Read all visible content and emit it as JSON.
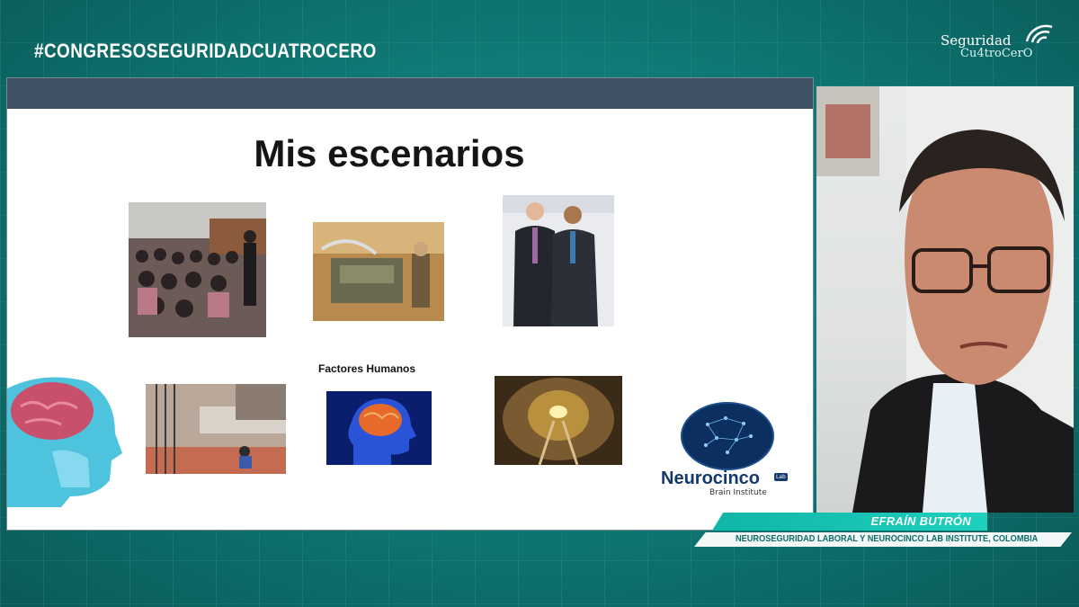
{
  "event": {
    "hashtag": "#CONGRESOSEGURIDADCUATROCERO",
    "brand_line1": "Seguridad",
    "brand_line2": "Cu4troCerO"
  },
  "slide": {
    "title": "Mis escenarios",
    "subheading": "Factores Humanos",
    "logo": {
      "name": "Neurocinco",
      "badge": "Lab",
      "subtitle": "Brain Institute"
    }
  },
  "speaker": {
    "name": "EFRAÍN BUTRÓN",
    "affiliation": "NEUROSEGURIDAD LABORAL Y NEUROCINCO LAB INSTITUTE, COLOMBIA"
  },
  "colors": {
    "background": "#0f7a76",
    "slide_header": "#3f5263",
    "name_bar": "#1fd0bf",
    "logo_text": "#123a6a"
  }
}
